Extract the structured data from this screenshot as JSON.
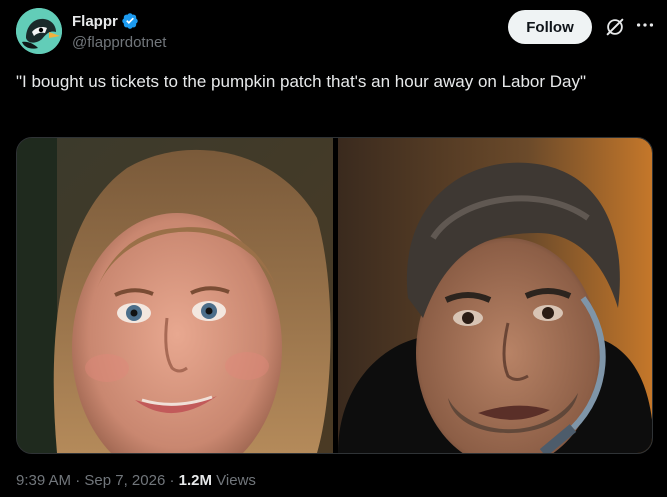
{
  "author": {
    "display_name": "Flappr",
    "handle": "@flapprdotnet",
    "verified": true,
    "avatar_icon": "flappr-bird-logo"
  },
  "actions": {
    "follow_label": "Follow",
    "grok_icon": "grok-icon",
    "more_icon": "more-icon"
  },
  "tweet": {
    "text": "\"I bought us tickets to the pumpkin patch that's an hour away on Labor Day\""
  },
  "media": {
    "count": 2,
    "items": [
      {
        "kind": "photo",
        "subject": "smiling woman"
      },
      {
        "kind": "photo",
        "subject": "man with headset"
      }
    ]
  },
  "meta": {
    "time": "9:39 AM",
    "sep1": "·",
    "date": "Sep 7, 2026",
    "sep2": "·",
    "views_count": "1.2M",
    "views_label": "Views"
  },
  "colors": {
    "background": "#000000",
    "text": "#e7e9ea",
    "secondary_text": "#71767b",
    "verified_blue": "#1d9bf0",
    "follow_bg": "#eff3f4"
  }
}
